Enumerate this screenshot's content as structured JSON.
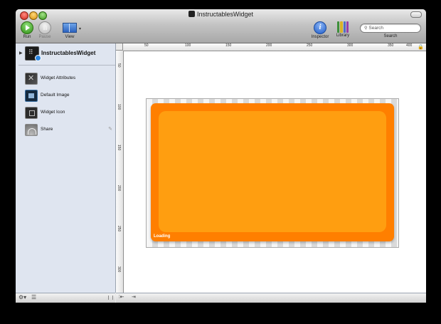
{
  "window": {
    "title": "InstructablesWidget"
  },
  "toolbar": {
    "run_label": "Run",
    "pause_label": "Pause",
    "view_label": "View",
    "inspector_label": "Inspector",
    "library_label": "Library",
    "search_placeholder": "Search",
    "search_label": "Search"
  },
  "sidebar": {
    "project_name": "InstructablesWidget",
    "items": [
      {
        "label": "Widget Attributes",
        "icon": "widget-attributes-icon"
      },
      {
        "label": "Default Image",
        "icon": "default-image-icon"
      },
      {
        "label": "Widget Icon",
        "icon": "widget-icon-icon"
      },
      {
        "label": "Share",
        "icon": "share-icon"
      }
    ]
  },
  "rulers": {
    "top_labels": [
      "50",
      "100",
      "150",
      "200",
      "250",
      "300",
      "350",
      "400"
    ],
    "left_labels": [
      "50",
      "100",
      "150",
      "200",
      "250",
      "300"
    ]
  },
  "widget": {
    "status_text": "Loading"
  },
  "colors": {
    "widget_outer": "#ff7f00",
    "widget_inner": "#ff9e10",
    "sidebar_bg": "#dfe5f0"
  }
}
